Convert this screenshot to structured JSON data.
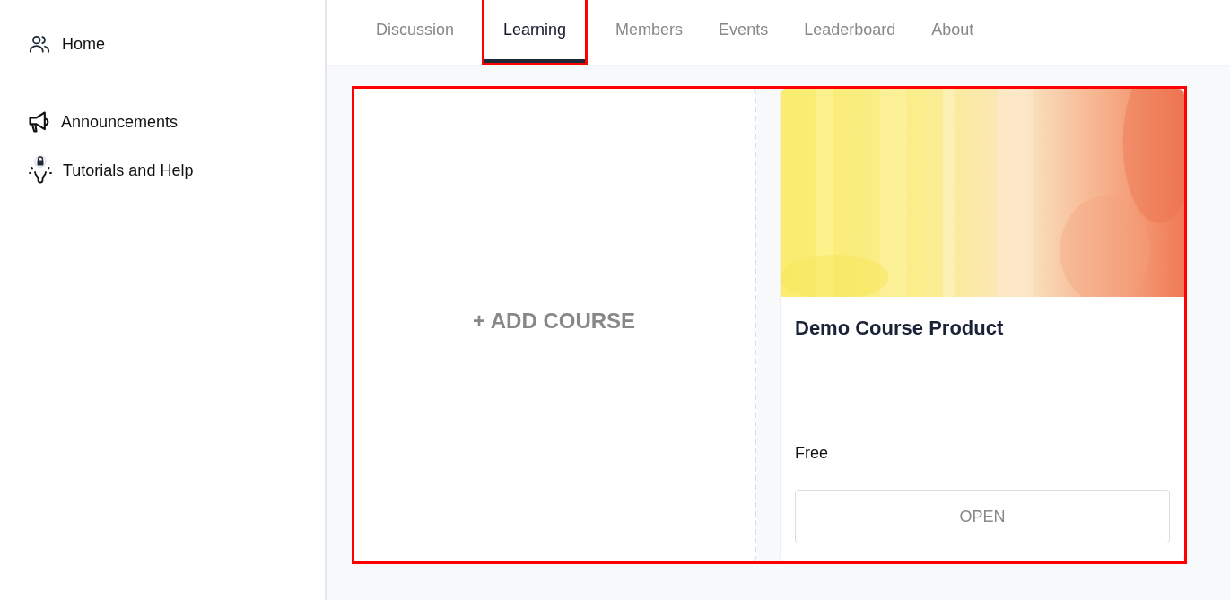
{
  "sidebar": {
    "groups": [
      [
        {
          "label": "Home",
          "kind": "people"
        }
      ],
      [
        {
          "label": "Announcements",
          "kind": "megaphone"
        },
        {
          "label": "Tutorials and Help",
          "kind": "bulb"
        }
      ]
    ]
  },
  "tabs": [
    {
      "label": "Discussion",
      "selected": false,
      "highlighted": false
    },
    {
      "label": "Learning",
      "selected": true,
      "highlighted": true
    },
    {
      "label": "Members",
      "selected": false,
      "highlighted": false
    },
    {
      "label": "Events",
      "selected": false,
      "highlighted": false
    },
    {
      "label": "Leaderboard",
      "selected": false,
      "highlighted": false
    },
    {
      "label": "About",
      "selected": false,
      "highlighted": false
    }
  ],
  "content": {
    "highlighted": true,
    "add_course": {
      "label": "+ ADD COURSE"
    },
    "courses": [
      {
        "title": "Demo Course Product",
        "price": "Free",
        "button": "OPEN"
      }
    ]
  }
}
